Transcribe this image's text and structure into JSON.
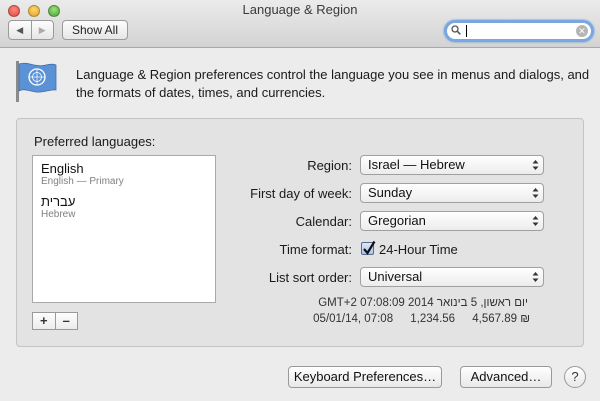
{
  "window": {
    "title": "Language & Region"
  },
  "toolbar": {
    "back_glyph": "◀",
    "forward_glyph": "▶",
    "show_all_label": "Show All",
    "search": {
      "value": "",
      "placeholder": ""
    }
  },
  "header": {
    "icon": "un-flag-icon",
    "description": "Language & Region preferences control the language you see in menus and dialogs, and the formats of dates, times, and currencies."
  },
  "preferred": {
    "label": "Preferred languages:",
    "languages": [
      {
        "name": "English",
        "subtitle": "English — Primary"
      },
      {
        "name": "עברית",
        "subtitle": "Hebrew"
      }
    ],
    "add_label": "+",
    "remove_label": "–"
  },
  "settings": {
    "region": {
      "label": "Region:",
      "value": "Israel — Hebrew"
    },
    "first_day": {
      "label": "First day of week:",
      "value": "Sunday"
    },
    "calendar": {
      "label": "Calendar:",
      "value": "Gregorian"
    },
    "time_format": {
      "label": "Time format:",
      "checkbox_label": "24-Hour Time",
      "checked": true
    },
    "sort_order": {
      "label": "List sort order:",
      "value": "Universal"
    }
  },
  "samples": {
    "long_date": "יום ראשון, 5 בינואר 2014 07:08:09 GMT+2",
    "short_date": "05/01/14, 07:08",
    "number": "1,234.56",
    "currency": "4,567.89 ₪"
  },
  "footer": {
    "keyboard_label": "Keyboard Preferences…",
    "advanced_label": "Advanced…",
    "help_label": "?"
  },
  "colors": {
    "focus_ring": "#7aa7e0",
    "window_bg": "#ececec",
    "checkbox_blue": "#a9c4ee"
  }
}
